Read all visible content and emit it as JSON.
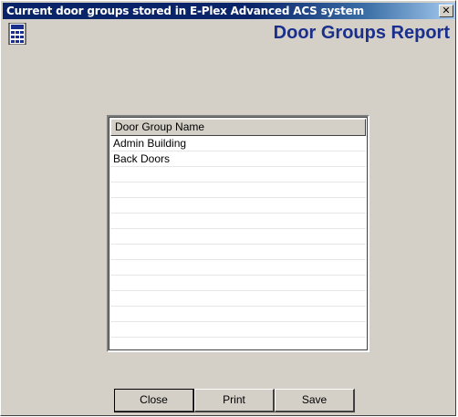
{
  "window": {
    "title": "Current door groups stored in E-Plex Advanced ACS system",
    "close_glyph": "✕"
  },
  "header": {
    "report_title": "Door Groups Report",
    "icon": "report-calculator-icon"
  },
  "list": {
    "column_header": "Door Group Name",
    "rows": [
      "Admin Building",
      "Back Doors",
      "",
      "",
      "",
      "",
      "",
      "",
      "",
      "",
      "",
      "",
      "",
      ""
    ]
  },
  "buttons": {
    "close": "Close",
    "print": "Print",
    "save": "Save"
  },
  "colors": {
    "title_bar": "#0a246a",
    "report_title": "#1a2f8c",
    "face": "#d4d0c8"
  }
}
